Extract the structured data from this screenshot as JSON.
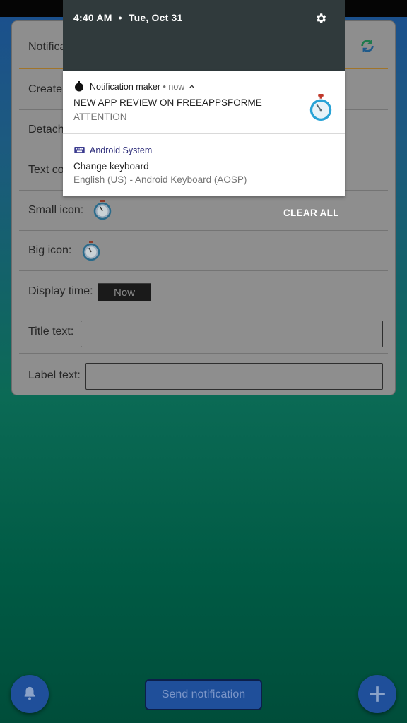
{
  "status_bar": {
    "time": "4:40 AM",
    "separator": "•",
    "date": "Tue, Oct 31"
  },
  "shade": {
    "settings_icon": "gear-icon",
    "clear_all_label": "CLEAR ALL"
  },
  "notifications": [
    {
      "app_name": "Notification maker",
      "meta": "• now",
      "expand_icon": "chevron-up-icon",
      "title": "NEW APP REVIEW ON FREEAPPSFORME",
      "text": "ATTENTION",
      "large_icon": "stopwatch-icon"
    },
    {
      "app_name": "Android System",
      "app_icon": "keyboard-icon",
      "title": "Change keyboard",
      "text": "English (US) - Android Keyboard (AOSP)"
    }
  ],
  "form": {
    "header_title": "Notifica",
    "refresh_icon": "refresh-icon",
    "rows": {
      "create_label": "Create",
      "detach_label": "Detach",
      "text_color_label": "Text co",
      "small_icon_label": "Small icon:",
      "big_icon_label": "Big icon:",
      "display_time_label": "Display time:",
      "display_time_value": "Now",
      "title_text_label": "Title text:",
      "title_text_value": "",
      "label_text_label": "Label text:",
      "label_text_value": ""
    }
  },
  "bottom": {
    "bell_icon": "bell-icon",
    "send_label": "Send notification",
    "add_icon": "plus-icon"
  },
  "colors": {
    "card_bg": "#8e8e8e",
    "header_underline": "#a0742a",
    "shade_header": "#303a3c",
    "fab": "#1f4f9a",
    "accent_blue": "#29a3d6"
  }
}
